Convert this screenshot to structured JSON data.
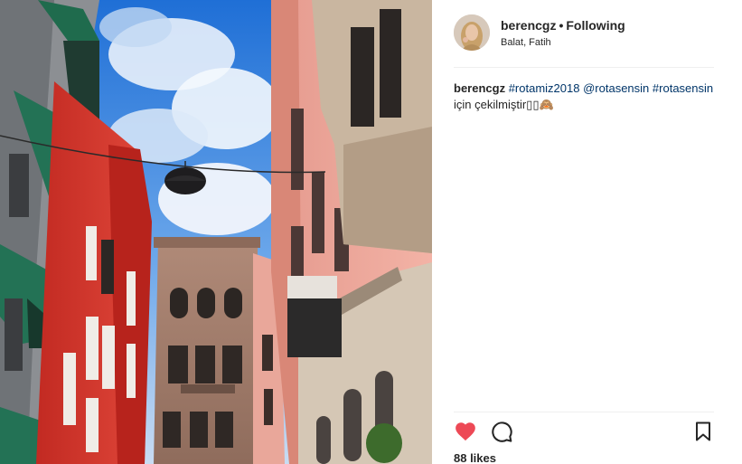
{
  "post": {
    "username": "berencgz",
    "separator": "•",
    "follow_status": "Following",
    "location": "Balat, Fatih",
    "caption": {
      "author": "berencgz",
      "hashtag_1": "#rotamiz2018",
      "mention": "@rotasensin",
      "hashtag_2": "#rotasensin",
      "text": "için çekilmiştir▯▯🙈"
    },
    "likes": "88 likes"
  },
  "colors": {
    "accent_link": "#003569",
    "like_red": "#ed4956",
    "divider": "#efefef"
  },
  "icons": {
    "like": "heart-filled-icon",
    "comment": "comment-bubble-icon",
    "save": "bookmark-icon"
  }
}
